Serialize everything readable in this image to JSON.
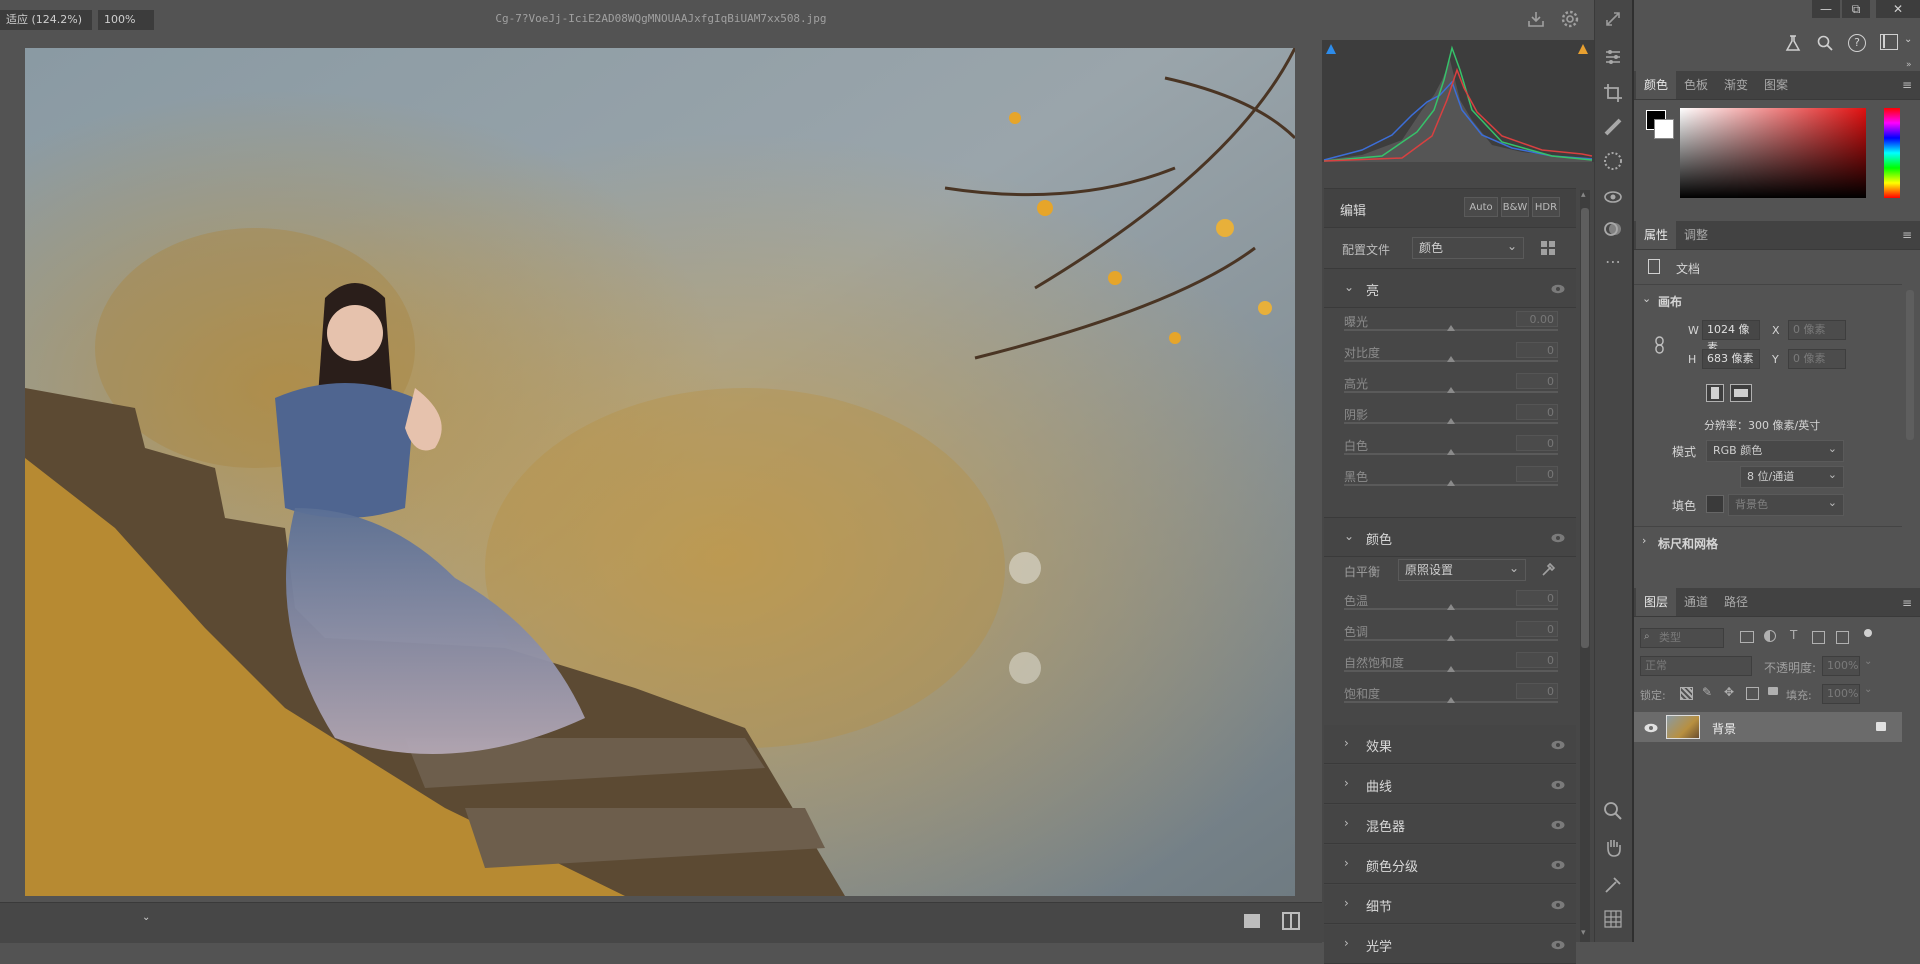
{
  "camera_raw": {
    "filename": "Cg-7?VoeJj-IciE2AD08WQgMNOUAAJxfgIqBiUAM7xx508.jpg",
    "status_zoom_fit": "适应 (124.2%)",
    "status_zoom": "100%",
    "panel": {
      "title": "编辑",
      "btn_auto": "Auto",
      "btn_bw": "B&W",
      "btn_hdr": "HDR",
      "profile_label": "配置文件",
      "profile_value": "颜色",
      "light": {
        "title": "亮",
        "sliders": [
          {
            "label": "曝光",
            "value": "0.00"
          },
          {
            "label": "对比度",
            "value": "0"
          },
          {
            "label": "高光",
            "value": "0"
          },
          {
            "label": "阴影",
            "value": "0"
          },
          {
            "label": "白色",
            "value": "0"
          },
          {
            "label": "黑色",
            "value": "0"
          }
        ]
      },
      "color": {
        "title": "颜色",
        "wb_label": "白平衡",
        "wb_value": "原照设置",
        "sliders": [
          {
            "label": "色温",
            "value": "0"
          },
          {
            "label": "色调",
            "value": "0"
          },
          {
            "label": "自然饱和度",
            "value": "0"
          },
          {
            "label": "饱和度",
            "value": "0"
          }
        ]
      },
      "collapsed_sections": [
        "效果",
        "曲线",
        "混色器",
        "颜色分级",
        "细节",
        "光学"
      ]
    }
  },
  "photoshop": {
    "window_controls": [
      "—",
      "⧉",
      "✕"
    ],
    "color_tabs": [
      "颜色",
      "色板",
      "渐变",
      "图案"
    ],
    "props_tabs": [
      "属性",
      "调整"
    ],
    "props_doc": "文档",
    "canvas_title": "画布",
    "w_label": "W",
    "w_value": "1024 像素",
    "x_label": "X",
    "x_value": "0 像素",
    "h_label": "H",
    "h_value": "683 像素",
    "y_label": "Y",
    "y_value": "0 像素",
    "resolution": "分辨率：300 像素/英寸",
    "mode_label": "模式",
    "mode_value": "RGB 颜色",
    "depth_value": "8 位/通道",
    "fill_label": "填色",
    "fill_value": "背景色",
    "rulers_title": "标尺和网格",
    "layers_tabs": [
      "图层",
      "通道",
      "路径"
    ],
    "layer_filter": "类型",
    "blend_mode": "正常",
    "opacity_label": "不透明度:",
    "opacity_value": "100%",
    "lock_label": "锁定:",
    "fill_pct_label": "填充:",
    "fill_pct_value": "100%",
    "layer_name": "背景"
  },
  "colors": {
    "bg": "#535353",
    "panel": "#474747",
    "accent_blue": "#2d8ceb"
  }
}
